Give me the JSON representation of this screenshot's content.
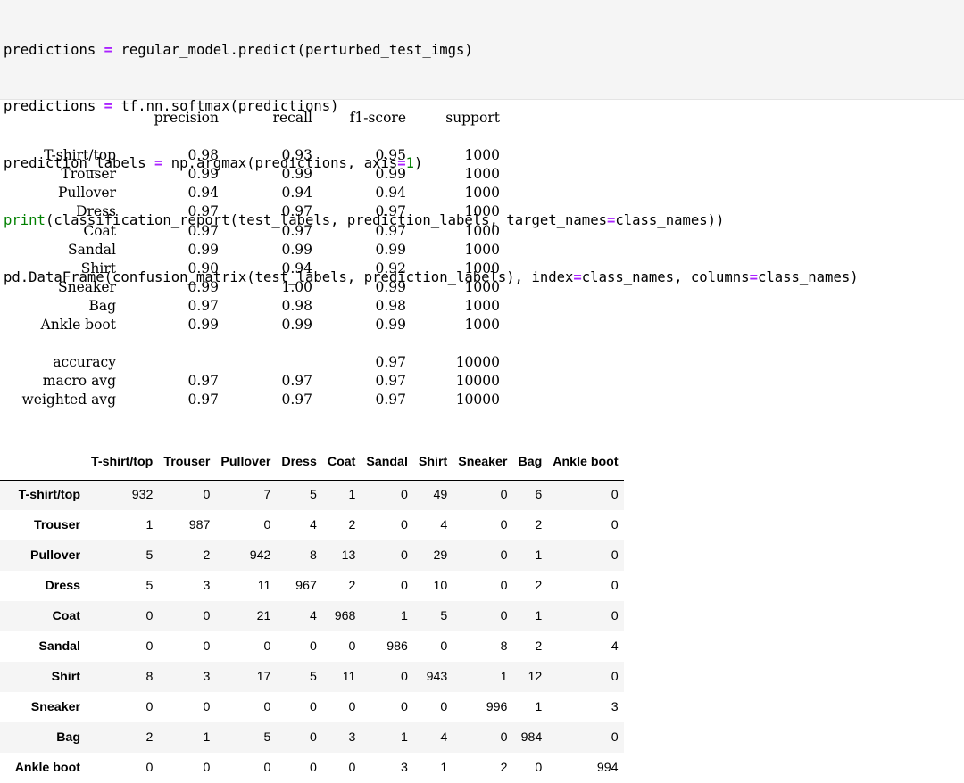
{
  "code_cell": {
    "line1": {
      "a": "predictions ",
      "op": "=",
      "b": " regular_model.predict(perturbed_test_imgs)"
    },
    "line2": {
      "a": "predictions ",
      "op": "=",
      "b": " tf.nn.softmax(predictions)"
    },
    "line3": {
      "a": "prediction_labels ",
      "op": "=",
      "b": " np.argmax(predictions, axis",
      "op2": "=",
      "num": "1",
      "c": ")"
    },
    "line4": {
      "kw": "print",
      "b": "(classification_report(test_labels, prediction_labels, target_names",
      "op": "=",
      "c": "class_names))"
    },
    "line5": {
      "a": "pd.DataFrame(confusion_matrix(test_labels, prediction_labels), index",
      "op": "=",
      "b": "class_names, columns",
      "op2": "=",
      "c": "class_names)"
    }
  },
  "report": {
    "header": {
      "precision": "precision",
      "recall": "recall",
      "f1": "f1-score",
      "support": "support"
    },
    "rows": [
      {
        "label": "T-shirt/top",
        "precision": "0.98",
        "recall": "0.93",
        "f1": "0.95",
        "support": "1000"
      },
      {
        "label": "Trouser",
        "precision": "0.99",
        "recall": "0.99",
        "f1": "0.99",
        "support": "1000"
      },
      {
        "label": "Pullover",
        "precision": "0.94",
        "recall": "0.94",
        "f1": "0.94",
        "support": "1000"
      },
      {
        "label": "Dress",
        "precision": "0.97",
        "recall": "0.97",
        "f1": "0.97",
        "support": "1000"
      },
      {
        "label": "Coat",
        "precision": "0.97",
        "recall": "0.97",
        "f1": "0.97",
        "support": "1000"
      },
      {
        "label": "Sandal",
        "precision": "0.99",
        "recall": "0.99",
        "f1": "0.99",
        "support": "1000"
      },
      {
        "label": "Shirt",
        "precision": "0.90",
        "recall": "0.94",
        "f1": "0.92",
        "support": "1000"
      },
      {
        "label": "Sneaker",
        "precision": "0.99",
        "recall": "1.00",
        "f1": "0.99",
        "support": "1000"
      },
      {
        "label": "Bag",
        "precision": "0.97",
        "recall": "0.98",
        "f1": "0.98",
        "support": "1000"
      },
      {
        "label": "Ankle boot",
        "precision": "0.99",
        "recall": "0.99",
        "f1": "0.99",
        "support": "1000"
      }
    ],
    "summary": [
      {
        "label": "accuracy",
        "precision": "",
        "recall": "",
        "f1": "0.97",
        "support": "10000"
      },
      {
        "label": "macro avg",
        "precision": "0.97",
        "recall": "0.97",
        "f1": "0.97",
        "support": "10000"
      },
      {
        "label": "weighted avg",
        "precision": "0.97",
        "recall": "0.97",
        "f1": "0.97",
        "support": "10000"
      }
    ]
  },
  "confusion_matrix": {
    "columns": [
      "T-shirt/top",
      "Trouser",
      "Pullover",
      "Dress",
      "Coat",
      "Sandal",
      "Shirt",
      "Sneaker",
      "Bag",
      "Ankle boot"
    ],
    "rows": [
      {
        "label": "T-shirt/top",
        "values": [
          "932",
          "0",
          "7",
          "5",
          "1",
          "0",
          "49",
          "0",
          "6",
          "0"
        ]
      },
      {
        "label": "Trouser",
        "values": [
          "1",
          "987",
          "0",
          "4",
          "2",
          "0",
          "4",
          "0",
          "2",
          "0"
        ]
      },
      {
        "label": "Pullover",
        "values": [
          "5",
          "2",
          "942",
          "8",
          "13",
          "0",
          "29",
          "0",
          "1",
          "0"
        ]
      },
      {
        "label": "Dress",
        "values": [
          "5",
          "3",
          "11",
          "967",
          "2",
          "0",
          "10",
          "0",
          "2",
          "0"
        ]
      },
      {
        "label": "Coat",
        "values": [
          "0",
          "0",
          "21",
          "4",
          "968",
          "1",
          "5",
          "0",
          "1",
          "0"
        ]
      },
      {
        "label": "Sandal",
        "values": [
          "0",
          "0",
          "0",
          "0",
          "0",
          "986",
          "0",
          "8",
          "2",
          "4"
        ]
      },
      {
        "label": "Shirt",
        "values": [
          "8",
          "3",
          "17",
          "5",
          "11",
          "0",
          "943",
          "1",
          "12",
          "0"
        ]
      },
      {
        "label": "Sneaker",
        "values": [
          "0",
          "0",
          "0",
          "0",
          "0",
          "0",
          "0",
          "996",
          "1",
          "3"
        ]
      },
      {
        "label": "Bag",
        "values": [
          "2",
          "1",
          "5",
          "0",
          "3",
          "1",
          "4",
          "0",
          "984",
          "0"
        ]
      },
      {
        "label": "Ankle boot",
        "values": [
          "0",
          "0",
          "0",
          "0",
          "0",
          "3",
          "1",
          "2",
          "0",
          "994"
        ]
      }
    ]
  }
}
